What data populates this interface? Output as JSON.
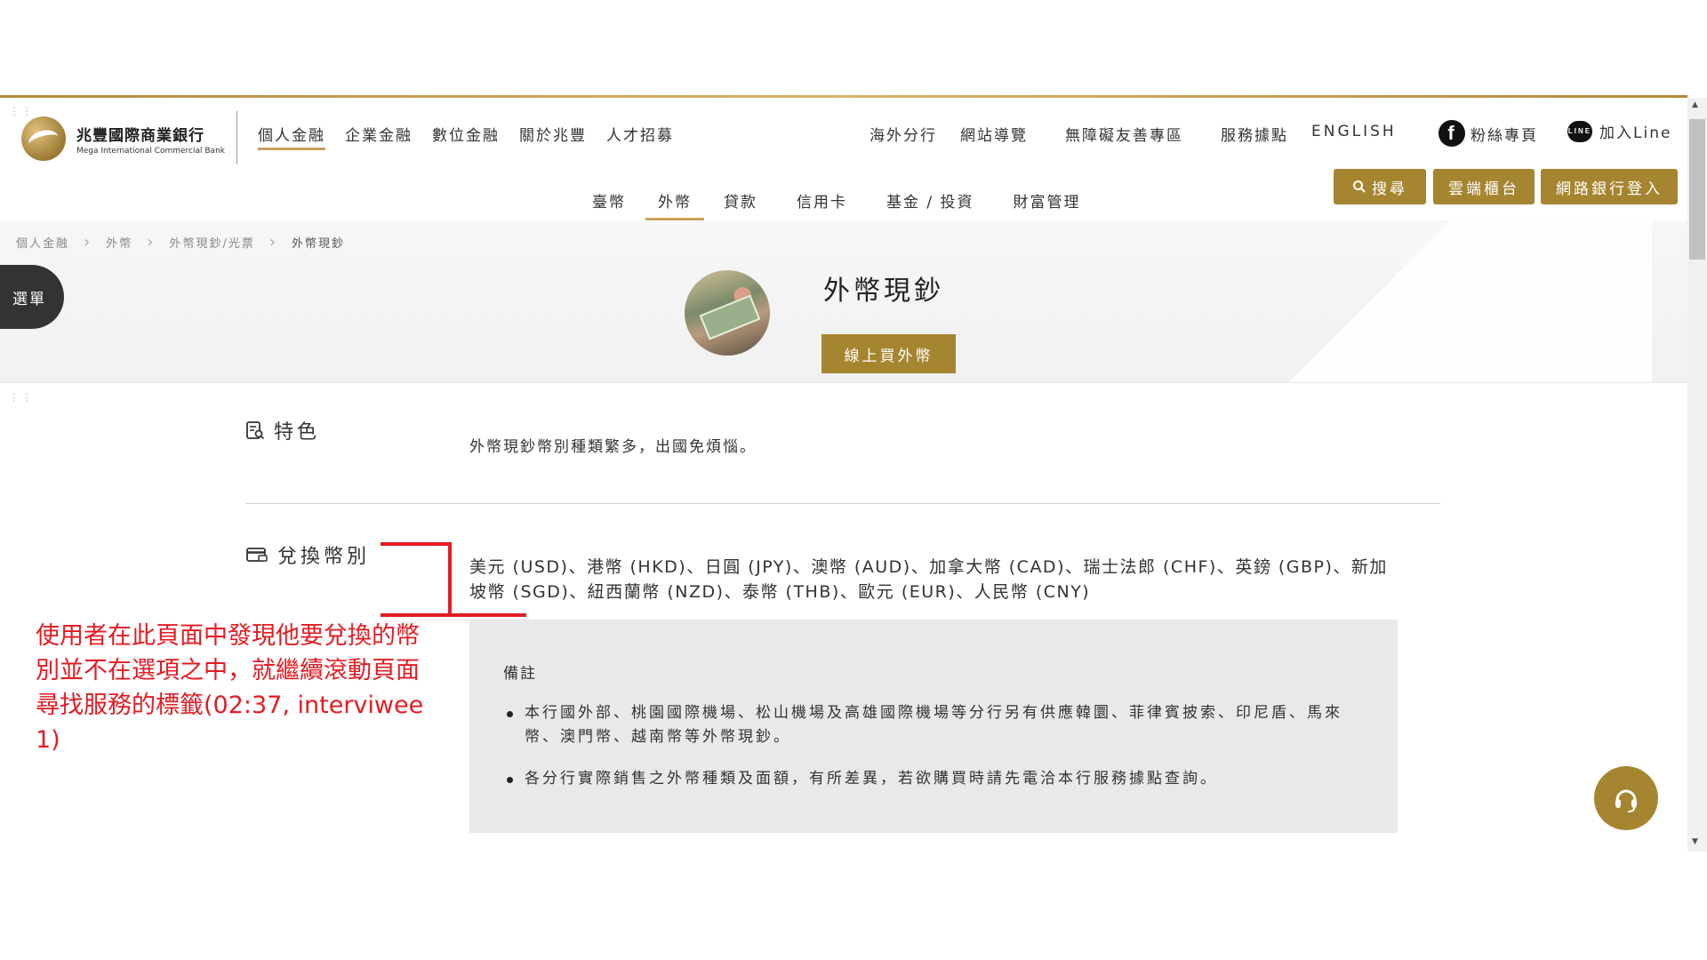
{
  "bank": {
    "name_cn": "兆豐國際商業銀行",
    "name_en": "Mega International Commercial Bank"
  },
  "main_nav": [
    "個人金融",
    "企業金融",
    "數位金融",
    "關於兆豐",
    "人才招募"
  ],
  "util_nav": [
    "海外分行",
    "網站導覽",
    "無障礙友善專區",
    "服務據點",
    "ENGLISH"
  ],
  "social": {
    "facebook_label": "粉絲專頁",
    "facebook_icon": "f",
    "line_label": "加入Line",
    "line_icon": "LINE"
  },
  "actions": {
    "search": "搜尋",
    "cloud_counter": "雲端櫃台",
    "ebank_login": "網路銀行登入"
  },
  "sub_nav": [
    "臺幣",
    "外幣",
    "貸款",
    "信用卡",
    "基金 / 投資",
    "財富管理"
  ],
  "breadcrumb": [
    "個人金融",
    "外幣",
    "外幣現鈔/光票",
    "外幣現鈔"
  ],
  "menu_label": "選單",
  "hero": {
    "title": "外幣現鈔",
    "buy_button": "線上買外幣"
  },
  "sections": {
    "feature": {
      "label": "特色",
      "text": "外幣現鈔幣別種類繁多，出國免煩惱。"
    },
    "exchange": {
      "label": "兌換幣別",
      "currencies": "美元 (USD)、港幣 (HKD)、日圓 (JPY)、澳幣 (AUD)、加拿大幣 (CAD)、瑞士法郎 (CHF)、英鎊 (GBP)、新加坡幣 (SGD)、紐西蘭幣 (NZD)、泰幣 (THB)、歐元 (EUR)、人民幣 (CNY)"
    }
  },
  "notes": {
    "title": "備註",
    "items": [
      "本行國外部、桃園國際機場、松山機場及高雄國際機場等分行另有供應韓圜、菲律賓披索、印尼盾、馬來幣、澳門幣、越南幣等外幣現鈔。",
      "各分行實際銷售之外幣種類及面額，有所差異，若欲購買時請先電洽本行服務據點查詢。"
    ]
  },
  "annotation": {
    "text": "使用者在此頁面中發現他要兌換的幣別並不在選項之中，就繼續滾動頁面尋找服務的標籤(02:37, interviwee 1)"
  },
  "colors": {
    "gold": "#a68530",
    "accent_line": "#c8a15a",
    "annotation_red": "#e21c23"
  }
}
